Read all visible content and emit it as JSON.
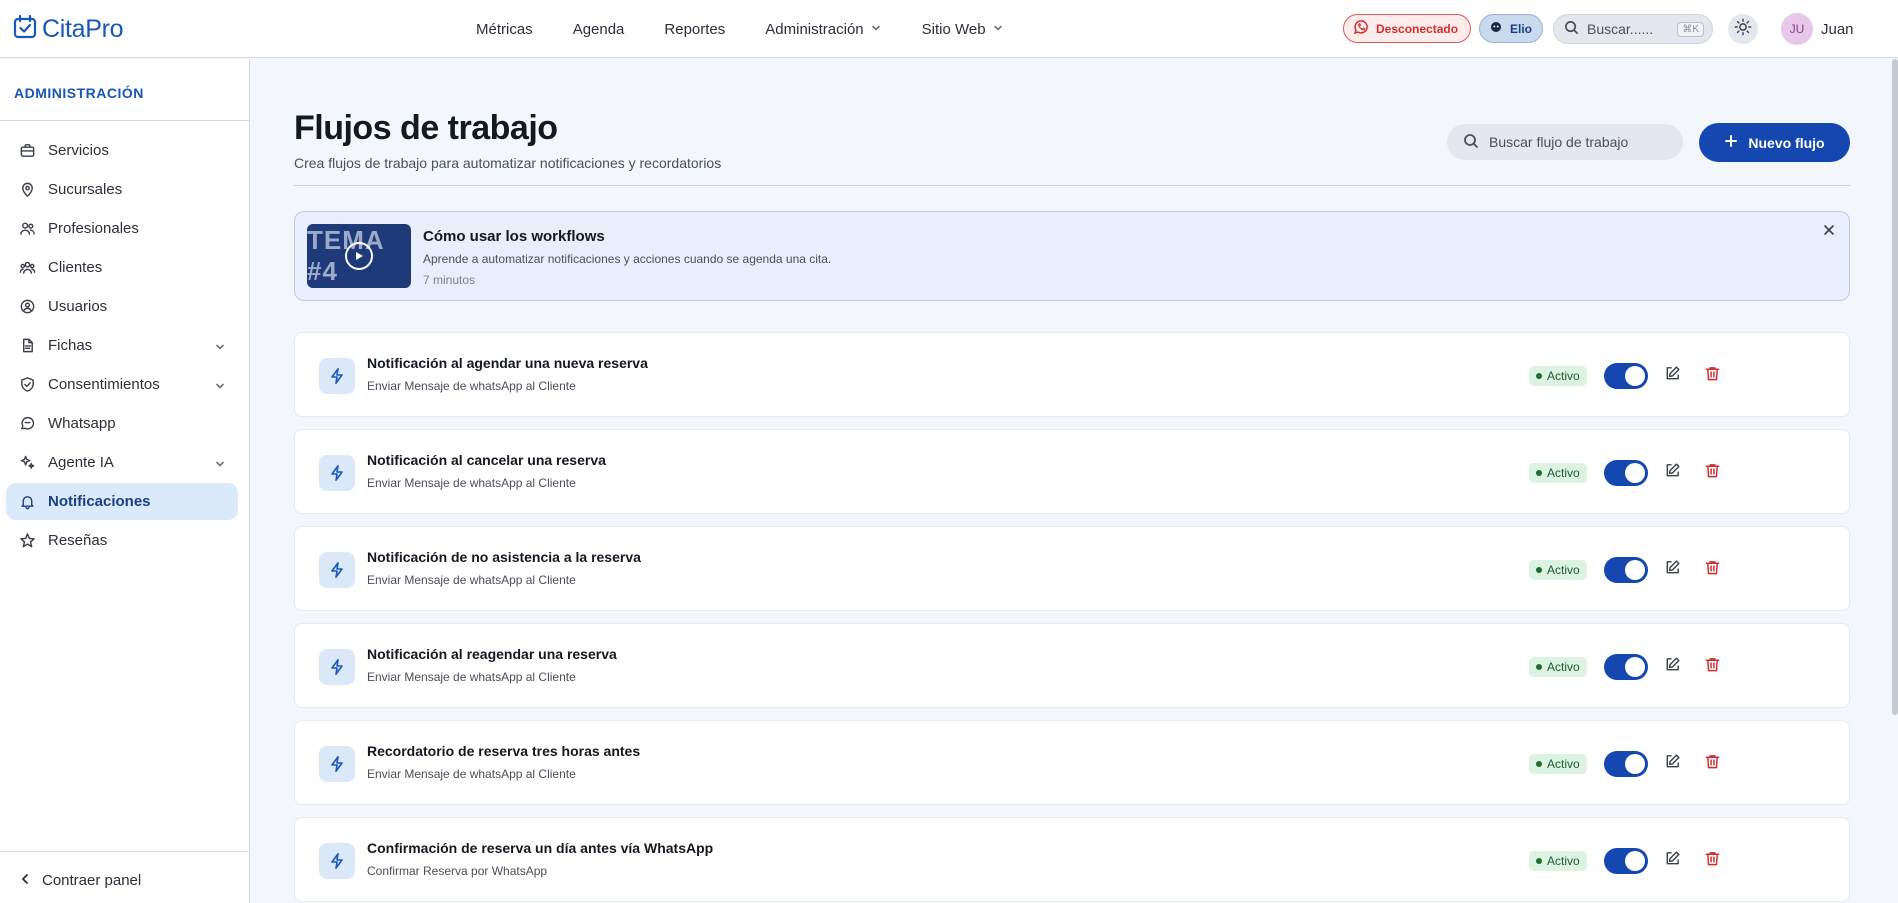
{
  "brand": {
    "name": "CitaPro"
  },
  "nav": [
    {
      "label": "Métricas",
      "has_dropdown": false
    },
    {
      "label": "Agenda",
      "has_dropdown": false
    },
    {
      "label": "Reportes",
      "has_dropdown": false
    },
    {
      "label": "Administración",
      "has_dropdown": true
    },
    {
      "label": "Sitio Web",
      "has_dropdown": true
    }
  ],
  "topbar": {
    "whatsapp_status": "Desconectado",
    "agent_name": "Elio",
    "search_placeholder": "Buscar......",
    "search_shortcut": "⌘K",
    "user_initials": "JU",
    "user_name": "Juan"
  },
  "sidebar": {
    "title": "ADMINISTRACIÓN",
    "items": [
      {
        "label": "Servicios",
        "icon": "briefcase-icon",
        "has_dropdown": false,
        "active": false
      },
      {
        "label": "Sucursales",
        "icon": "map-pin-icon",
        "has_dropdown": false,
        "active": false
      },
      {
        "label": "Profesionales",
        "icon": "users-icon",
        "has_dropdown": false,
        "active": false
      },
      {
        "label": "Clientes",
        "icon": "group-icon",
        "has_dropdown": false,
        "active": false
      },
      {
        "label": "Usuarios",
        "icon": "user-circle-icon",
        "has_dropdown": false,
        "active": false
      },
      {
        "label": "Fichas",
        "icon": "file-icon",
        "has_dropdown": true,
        "active": false
      },
      {
        "label": "Consentimientos",
        "icon": "shield-check-icon",
        "has_dropdown": true,
        "active": false
      },
      {
        "label": "Whatsapp",
        "icon": "chat-icon",
        "has_dropdown": false,
        "active": false
      },
      {
        "label": "Agente IA",
        "icon": "sparkles-icon",
        "has_dropdown": true,
        "active": false
      },
      {
        "label": "Notificaciones",
        "icon": "bell-icon",
        "has_dropdown": false,
        "active": true
      },
      {
        "label": "Reseñas",
        "icon": "star-icon",
        "has_dropdown": false,
        "active": false
      }
    ],
    "collapse_label": "Contraer panel"
  },
  "page": {
    "title": "Flujos de trabajo",
    "subtitle": "Crea flujos de trabajo para automatizar notificaciones y recordatorios",
    "search_placeholder": "Buscar flujo de trabajo",
    "new_button": "Nuevo flujo"
  },
  "banner": {
    "thumbnail_text": "TEMA #4",
    "title": "Cómo usar los workflows",
    "description": "Aprende a automatizar notificaciones y acciones cuando se agenda una cita.",
    "duration": "7 minutos"
  },
  "flows": [
    {
      "title": "Notificación al agendar una nueva reserva",
      "action": "Enviar Mensaje de whatsApp al Cliente",
      "status": "Activo",
      "enabled": true
    },
    {
      "title": "Notificación al cancelar una reserva",
      "action": "Enviar Mensaje de whatsApp al Cliente",
      "status": "Activo",
      "enabled": true
    },
    {
      "title": "Notificación de no asistencia a la reserva",
      "action": "Enviar Mensaje de whatsApp al Cliente",
      "status": "Activo",
      "enabled": true
    },
    {
      "title": "Notificación al reagendar una reserva",
      "action": "Enviar Mensaje de whatsApp al Cliente",
      "status": "Activo",
      "enabled": true
    },
    {
      "title": "Recordatorio de reserva tres horas antes",
      "action": "Enviar Mensaje de whatsApp al Cliente",
      "status": "Activo",
      "enabled": true
    },
    {
      "title": "Confirmación de reserva un día antes vía WhatsApp",
      "action": "Confirmar Reserva por WhatsApp",
      "status": "Activo",
      "enabled": true
    }
  ],
  "colors": {
    "accent": "#1547b0",
    "brand": "#1a56b8",
    "active_badge_bg": "#dcf3e2",
    "danger": "#d32f2f"
  }
}
